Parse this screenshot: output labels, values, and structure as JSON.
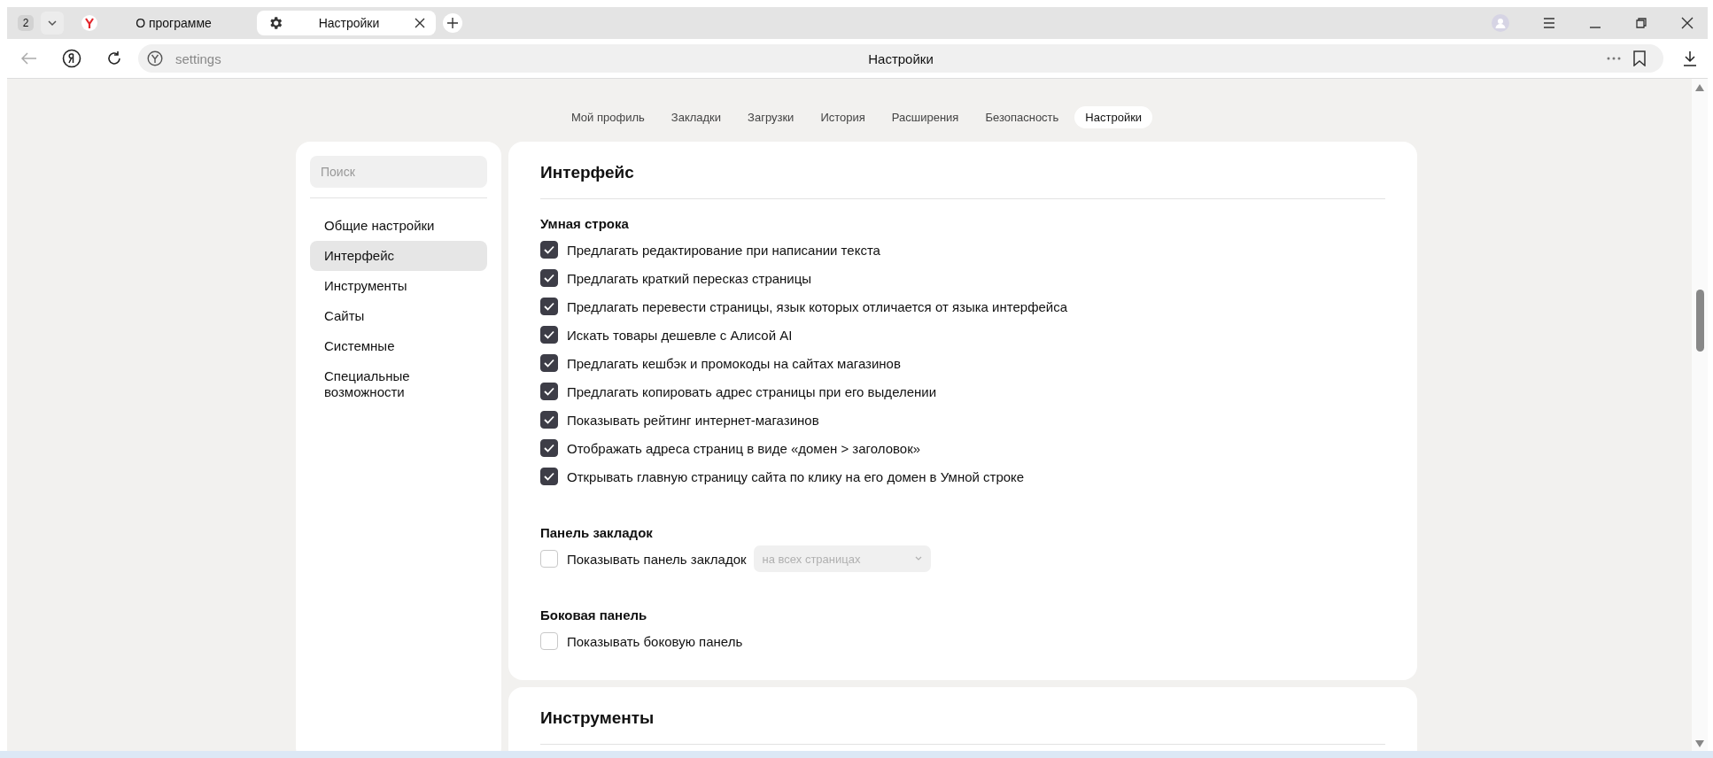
{
  "browser": {
    "tab_count": "2",
    "tabs": [
      {
        "title": "О программе",
        "kind": "logo",
        "selected": false
      },
      {
        "title": "Настройки",
        "kind": "gear",
        "selected": true
      }
    ],
    "address": "settings",
    "page_title": "Настройки"
  },
  "nav": [
    {
      "label": "Мой профиль",
      "selected": false
    },
    {
      "label": "Закладки",
      "selected": false
    },
    {
      "label": "Загрузки",
      "selected": false
    },
    {
      "label": "История",
      "selected": false
    },
    {
      "label": "Расширения",
      "selected": false
    },
    {
      "label": "Безопасность",
      "selected": false
    },
    {
      "label": "Настройки",
      "selected": true
    }
  ],
  "sidebar": {
    "search": {
      "placeholder": "Поиск"
    },
    "items": [
      {
        "label": "Общие настройки",
        "selected": false
      },
      {
        "label": "Интерфейс",
        "selected": true
      },
      {
        "label": "Инструменты",
        "selected": false
      },
      {
        "label": "Сайты",
        "selected": false
      },
      {
        "label": "Системные",
        "selected": false
      },
      {
        "label": "Специальные возможности",
        "selected": false
      }
    ]
  },
  "sections": [
    {
      "title": "Интерфейс",
      "groups": [
        {
          "heading": "Умная строка",
          "options": [
            {
              "label": "Предлагать редактирование при написании текста",
              "checked": true
            },
            {
              "label": "Предлагать краткий пересказ страницы",
              "checked": true
            },
            {
              "label": "Предлагать перевести страницы, язык которых отличается от языка интерфейса",
              "checked": true
            },
            {
              "label": "Искать товары дешевле с Алисой AI",
              "checked": true
            },
            {
              "label": "Предлагать кешбэк и промокоды на сайтах магазинов",
              "checked": true
            },
            {
              "label": "Предлагать копировать адрес страницы при его выделении",
              "checked": true
            },
            {
              "label": "Показывать рейтинг интернет-магазинов",
              "checked": true
            },
            {
              "label": "Отображать адреса страниц в виде «домен > заголовок»",
              "checked": true
            },
            {
              "label": "Открывать главную страницу сайта по клику на его домен в Умной строке",
              "checked": true
            }
          ]
        },
        {
          "heading": "Панель закладок",
          "options": [
            {
              "label": "Показывать панель закладок",
              "checked": false,
              "dropdown": {
                "value": "на всех страницах",
                "disabled": true
              }
            }
          ]
        },
        {
          "heading": "Боковая панель",
          "options": [
            {
              "label": "Показывать боковую панель",
              "checked": false
            }
          ]
        }
      ]
    },
    {
      "title": "Инструменты"
    }
  ]
}
